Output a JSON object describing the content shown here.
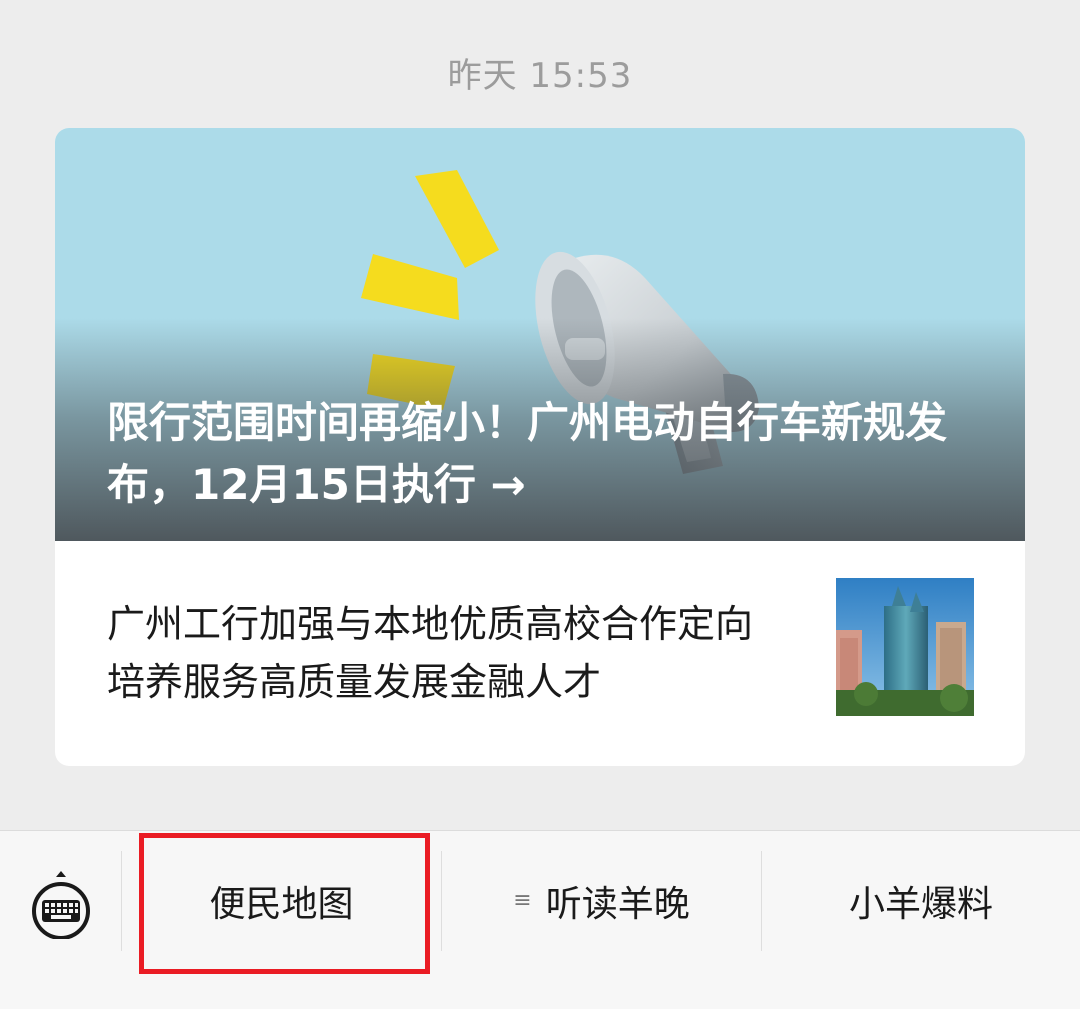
{
  "timestamp": "昨天 15:53",
  "article_card": {
    "hero": {
      "title": "限行范围时间再缩小！广州电动自行车新规发布，12月15日执行 →",
      "image_icon": "megaphone-icon",
      "background_color": "#acdbe9",
      "accent_color": "#f5dc1e"
    },
    "sub_article": {
      "title": "广州工行加强与本地优质高校合作定向培养服务高质量发展金融人才",
      "thumbnail": "city-buildings-thumbnail"
    }
  },
  "menu_bar": {
    "keyboard_icon": "keyboard-icon",
    "items": [
      {
        "label": "便民地图",
        "has_submenu": false
      },
      {
        "label": "听读羊晚",
        "has_submenu": true,
        "submenu_icon": "≡"
      },
      {
        "label": "小羊爆料",
        "has_submenu": false
      }
    ],
    "highlight_color": "#ea1c24"
  }
}
